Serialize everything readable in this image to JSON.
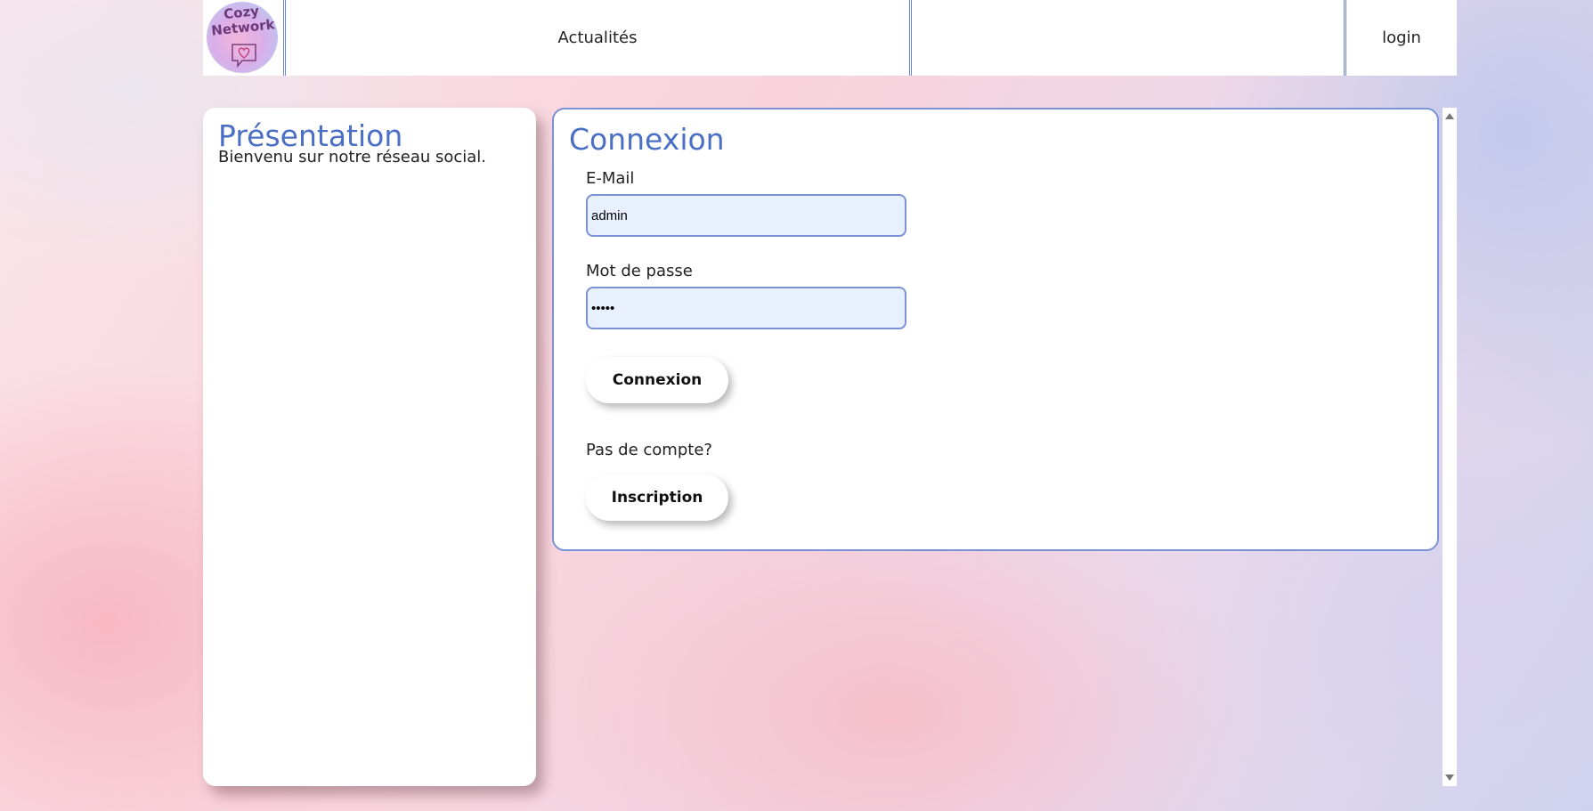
{
  "logo": {
    "line1": "Cozy",
    "line2": "Network"
  },
  "nav": {
    "news": "Actualités",
    "middle": "",
    "login": "login"
  },
  "presentation": {
    "title": "Présentation",
    "text": "Bienvenu sur notre réseau social."
  },
  "login_form": {
    "title": "Connexion",
    "email_label": "E-Mail",
    "email_value": "admin",
    "password_label": "Mot de passe",
    "password_value": "•••••",
    "submit_label": "Connexion",
    "no_account_text": "Pas de compte?",
    "register_label": "Inscription"
  },
  "colors": {
    "accent": "#4a6fc4",
    "border": "#7b93d6",
    "input_bg": "#e8effd"
  }
}
